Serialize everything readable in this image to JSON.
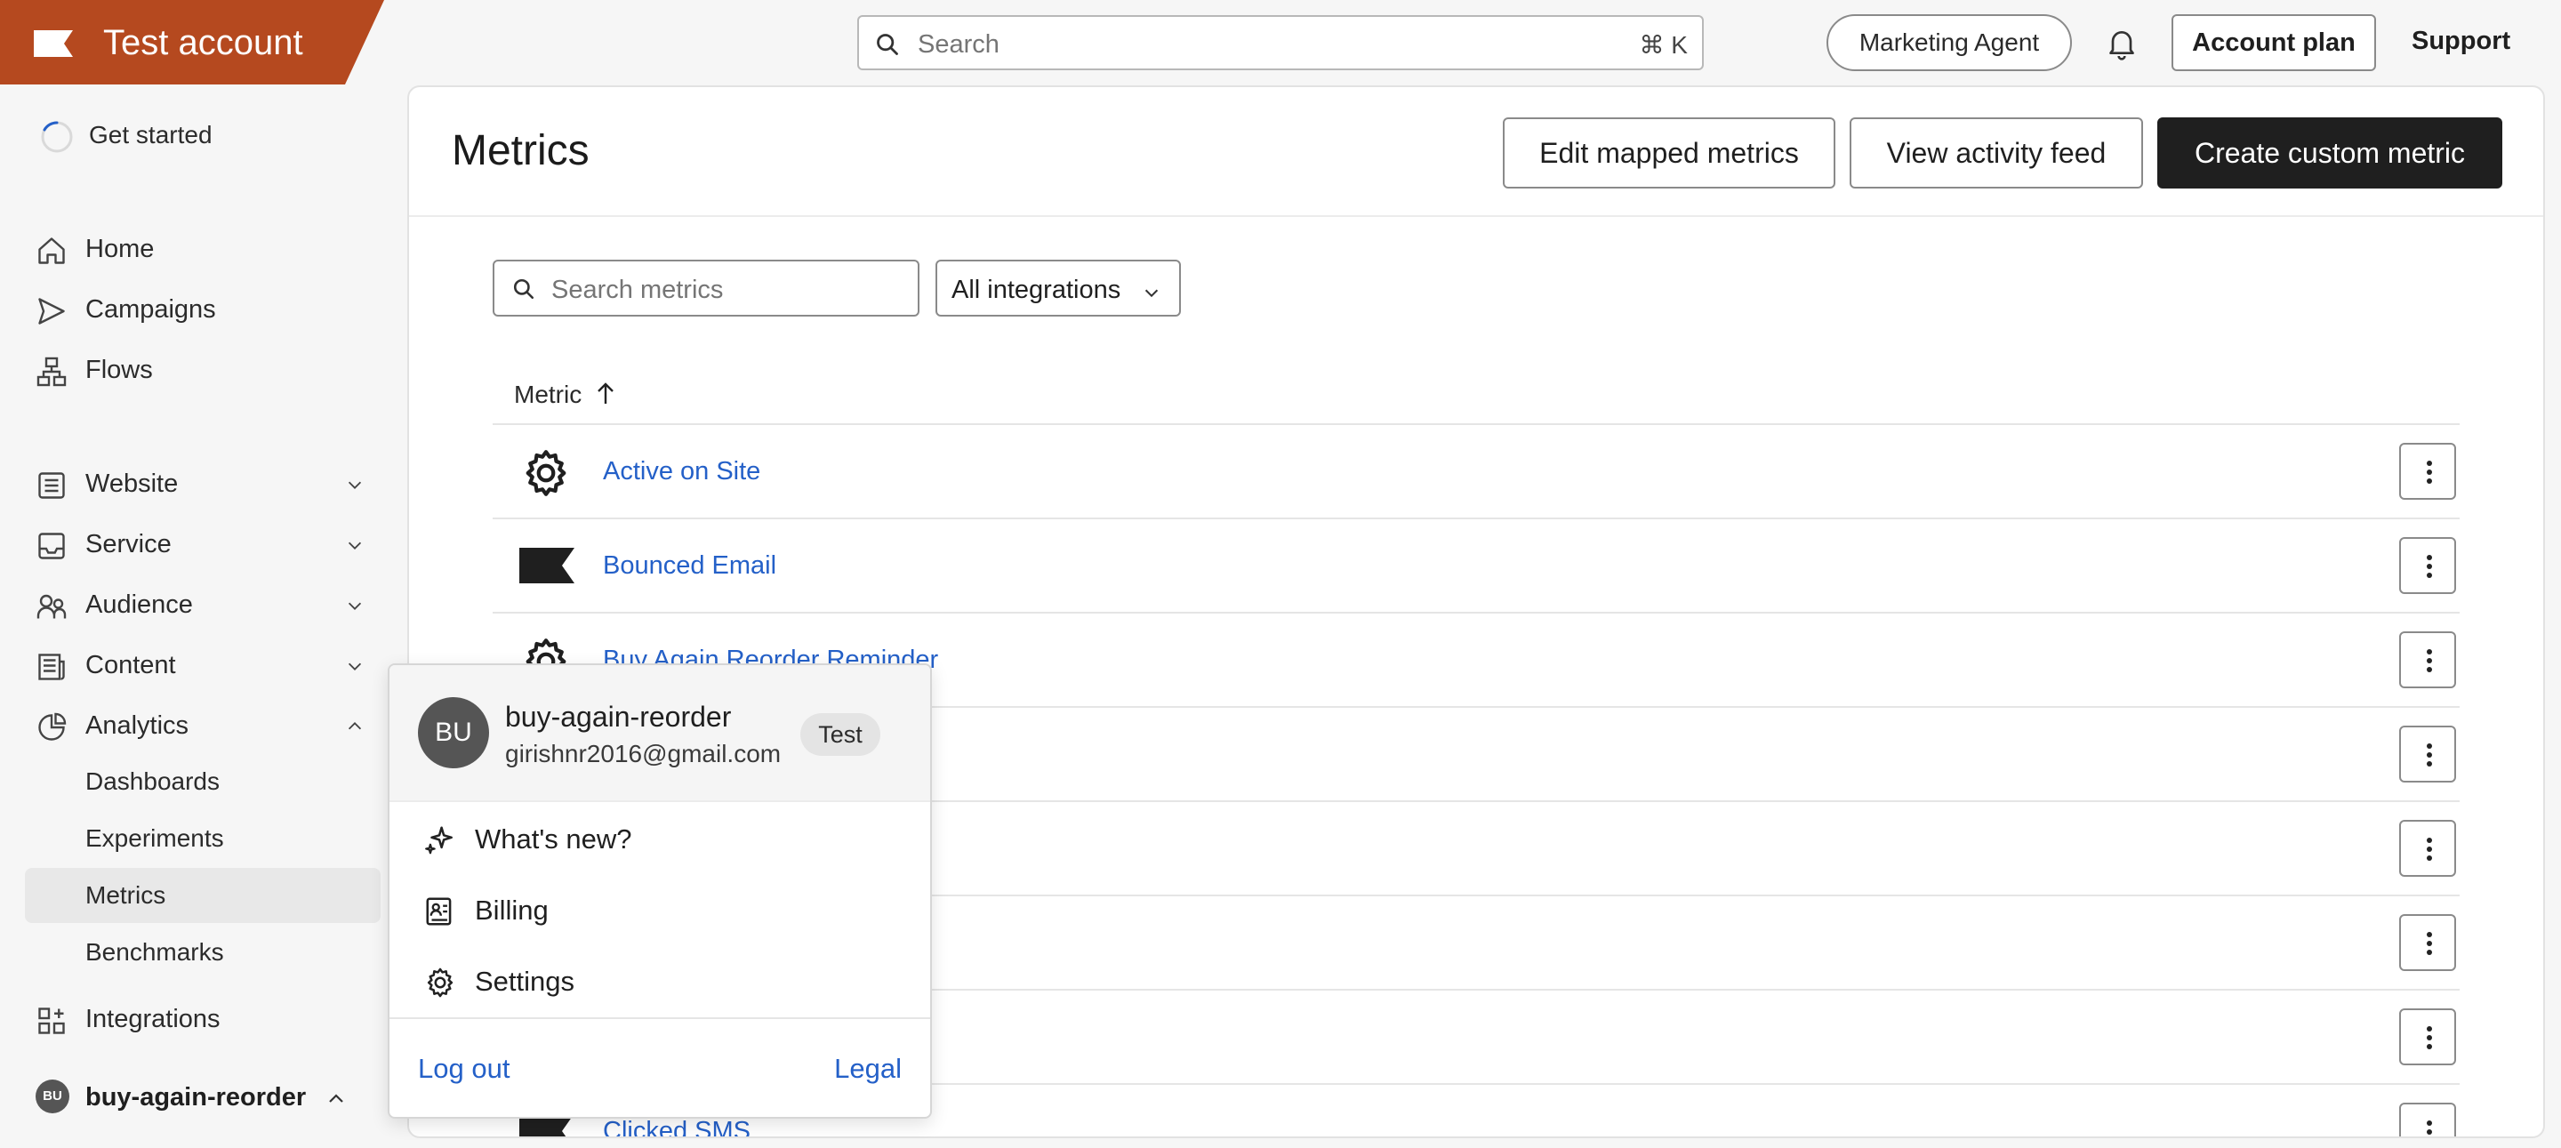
{
  "topbar": {
    "account_title": "Test account",
    "search_placeholder": "Search",
    "search_shortcut": "⌘ K",
    "marketing_agent": "Marketing Agent",
    "account_plan": "Account plan",
    "support": "Support",
    "brand_color": "#b5491f"
  },
  "sidebar": {
    "get_started": "Get started",
    "items": [
      {
        "label": "Home",
        "icon": "home-icon"
      },
      {
        "label": "Campaigns",
        "icon": "send-icon"
      },
      {
        "label": "Flows",
        "icon": "flow-icon"
      },
      {
        "label": "Website",
        "icon": "document-icon"
      },
      {
        "label": "Service",
        "icon": "inbox-icon"
      },
      {
        "label": "Audience",
        "icon": "people-icon"
      },
      {
        "label": "Content",
        "icon": "newspaper-icon"
      },
      {
        "label": "Analytics",
        "icon": "pie-chart-icon"
      }
    ],
    "analytics_sub": [
      "Dashboards",
      "Experiments",
      "Metrics",
      "Benchmarks"
    ],
    "integrations": "Integrations",
    "user_initials": "BU",
    "user_name": "buy-again-reorder"
  },
  "main": {
    "title": "Metrics",
    "buttons": {
      "edit": "Edit mapped metrics",
      "activity": "View activity feed",
      "create": "Create custom metric"
    },
    "search_placeholder": "Search metrics",
    "filter_value": "All integrations",
    "column_header": "Metric",
    "rows": [
      {
        "name": "Active on Site",
        "icon": "gear-icon"
      },
      {
        "name": "Bounced Email",
        "icon": "flag-icon"
      },
      {
        "name": "Buy Again Reorder Reminder",
        "icon": "gear-icon"
      },
      {
        "name": "",
        "icon": ""
      },
      {
        "name": "",
        "icon": ""
      },
      {
        "name": "",
        "icon": ""
      },
      {
        "name": "",
        "icon": ""
      },
      {
        "name": "Clicked SMS",
        "icon": "flag-icon"
      }
    ],
    "link_color": "#2460c8"
  },
  "popup": {
    "initials": "BU",
    "name": "buy-again-reorder",
    "email": "girishnr2016@gmail.com",
    "tag": "Test",
    "items": [
      {
        "label": "What's new?",
        "icon": "sparkle-icon"
      },
      {
        "label": "Billing",
        "icon": "billing-icon"
      },
      {
        "label": "Settings",
        "icon": "gear-icon"
      }
    ],
    "logout": "Log out",
    "legal": "Legal"
  }
}
